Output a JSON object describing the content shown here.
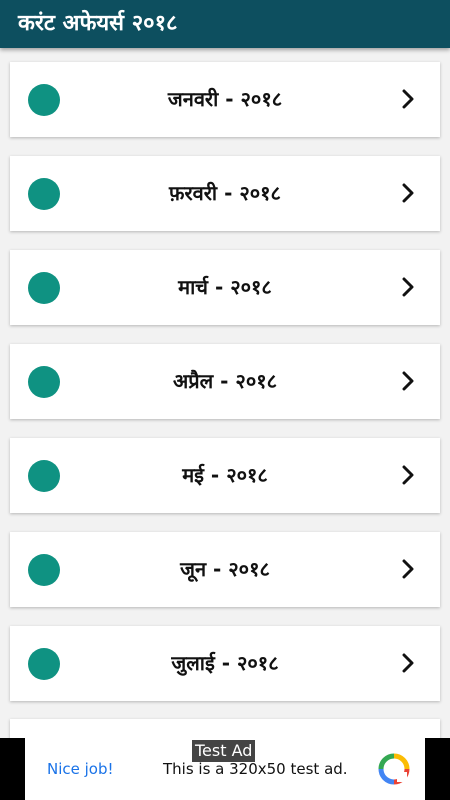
{
  "appbar": {
    "title": "करंट अफेयर्स २०१८"
  },
  "months": [
    {
      "label": "जनवरी - २०१८"
    },
    {
      "label": "फ़रवरी - २०१८"
    },
    {
      "label": "मार्च - २०१८"
    },
    {
      "label": "अप्रैल - २०१८"
    },
    {
      "label": "मई - २०१८"
    },
    {
      "label": "जून - २०१८"
    },
    {
      "label": "जुलाई - २०१८"
    }
  ],
  "ad": {
    "tag": "Test Ad",
    "nice_job": "Nice job!",
    "text": "This is a 320x50 test ad."
  },
  "colors": {
    "appbar": "#0d4f5f",
    "dot": "#0f9282",
    "background": "#f2f2f2"
  },
  "icons": {
    "row_arrow": "chevron-right-icon",
    "ad_logo": "ad-choices-logo-icon"
  }
}
